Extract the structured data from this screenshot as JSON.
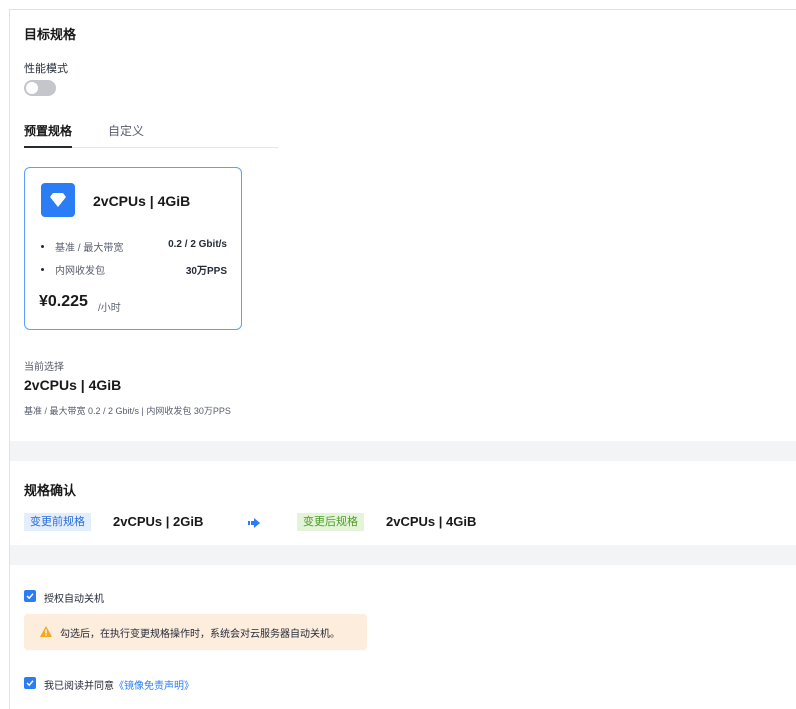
{
  "target_spec": {
    "title": "目标规格",
    "perf_mode_label": "性能模式",
    "perf_mode_on": false,
    "tabs": {
      "preset": "预置规格",
      "custom": "自定义"
    },
    "card": {
      "name": "2vCPUs | 4GiB",
      "rows": [
        {
          "label": "基准 / 最大带宽",
          "value": "0.2 / 2 Gbit/s"
        },
        {
          "label": "内网收发包",
          "value": "30万PPS"
        }
      ],
      "price": "¥0.225",
      "unit": "/小时"
    },
    "current_label": "当前选择",
    "current_spec": "2vCPUs | 4GiB",
    "current_detail": "基准 / 最大带宽  0.2 / 2 Gbit/s  |  内网收发包  30万PPS"
  },
  "confirm": {
    "title": "规格确认",
    "before_tag": "变更前规格",
    "before_spec": "2vCPUs | 2GiB",
    "after_tag": "变更后规格",
    "after_spec": "2vCPUs | 4GiB"
  },
  "options": {
    "auto_shutdown_label": "授权自动关机",
    "auto_shutdown_checked": true,
    "warning_text": "勾选后，在执行变更规格操作时，系统会对云服务器自动关机。",
    "agree_prefix": "我已阅读并同意",
    "agree_link": "《镜像免责声明》",
    "agree_checked": true
  },
  "colors": {
    "accent": "#2a7df5",
    "warning": "#f5a623",
    "warning_bg": "#fdeddc"
  }
}
